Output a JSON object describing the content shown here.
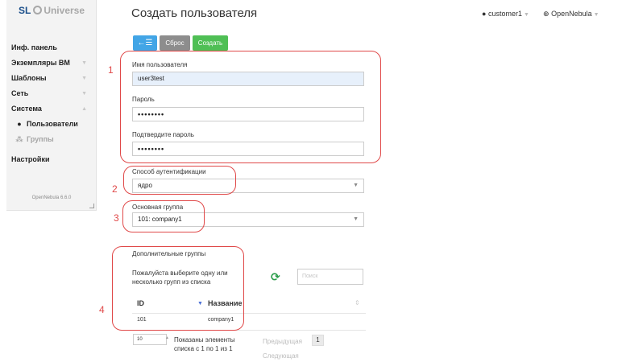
{
  "sidebar": {
    "logo_sl": "SL",
    "logo_universe": "Universe",
    "items": [
      {
        "label": "Инф. панель"
      },
      {
        "label": "Экземпляры ВМ"
      },
      {
        "label": "Шаблоны"
      },
      {
        "label": "Сеть"
      },
      {
        "label": "Система"
      },
      {
        "label": "Пользователи"
      },
      {
        "label": "Группы"
      },
      {
        "label": "Настройки"
      }
    ],
    "version": "OpenNebula 6.6.0"
  },
  "header": {
    "title": "Создать пользователя",
    "user": "customer1",
    "zone": "OpenNebula"
  },
  "toolbar": {
    "back_icon": "←☰",
    "reset_label": "Сброс",
    "create_label": "Создать"
  },
  "form": {
    "username_label": "Имя пользователя",
    "username_value": "user3test",
    "password_label": "Пароль",
    "password_value": "••••••••",
    "confirm_label": "Подтвердите пароль",
    "confirm_value": "••••••••",
    "auth_label": "Способ аутентификации",
    "auth_value": "ядро",
    "group_label": "Основная группа",
    "group_value": "101: company1",
    "extra_groups_label": "Дополнительные группы"
  },
  "groups_table": {
    "hint": "Пожалуйста выберите одну или несколько групп из списка",
    "search_placeholder": "Поиск",
    "columns": [
      "ID",
      "Название"
    ],
    "rows": [
      {
        "id": "101",
        "name": "company1"
      }
    ],
    "page_size": "10",
    "info": "Показаны элементы списка с 1 по 1 из 1",
    "prev": "Предыдущая",
    "next": "Следующая",
    "page": "1"
  },
  "annotations": [
    "1",
    "2",
    "3",
    "4"
  ],
  "colors": {
    "highlight": "#e04848",
    "back_button": "#42a5e6",
    "reset_button": "#8d8d8d",
    "create_button": "#4fbf55"
  }
}
